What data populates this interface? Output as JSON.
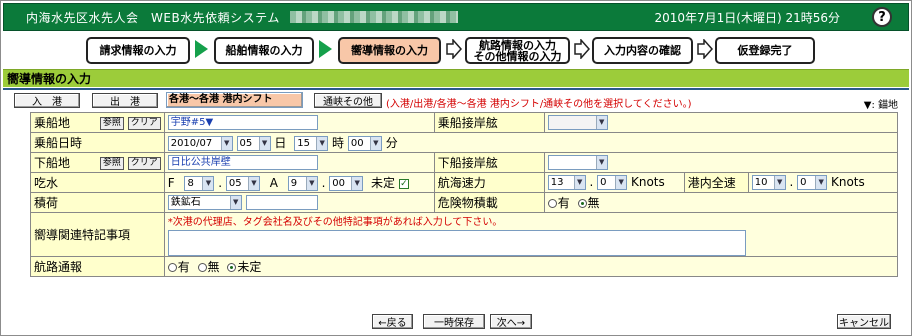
{
  "header": {
    "title": "内海水先区水先人会　WEB水先依頼システム",
    "datetime": "2010年7月1日(木曜日) 21時56分",
    "help_label": "?"
  },
  "steps": [
    {
      "label": "請求情報の入力"
    },
    {
      "label": "船舶情報の入力"
    },
    {
      "label": "嚮導情報の入力"
    },
    {
      "label": "航路情報の入力\nその他情報の入力"
    },
    {
      "label": "入力内容の確認"
    },
    {
      "label": "仮登録完了"
    }
  ],
  "section_title": "嚮導情報の入力",
  "tabs": {
    "entry": "入　港",
    "exit": "出　港",
    "shift": "各港〜各港 港内シフト",
    "other": "通峡その他"
  },
  "tab_note": "(入港/出港/各港〜各港 港内シフト/通峡その他を選択してください。)",
  "legend": "▼: 錨地",
  "form": {
    "boarding_place_label": "乗船地",
    "ref_label": "参照",
    "clear_label": "クリア",
    "boarding_place_value": "宇野#5▼",
    "boarding_berth_label": "乗船接岸舷",
    "boarding_datetime_label": "乗船日時",
    "date_value": "2010/07",
    "day_value": "05",
    "day_unit": "日",
    "hour_value": "15",
    "hour_unit": "時",
    "minute_value": "00",
    "minute_unit": "分",
    "landing_place_label": "下船地",
    "landing_place_value": "日比公共岸壁",
    "landing_berth_label": "下船接岸舷",
    "draft_label": "吃水",
    "fore_label": "F",
    "fore_m": "8",
    "fore_cm": "05",
    "aft_label": "A",
    "aft_m": "9",
    "aft_cm": "00",
    "undecided_label": "未定",
    "nav_speed_label": "航海速力",
    "nav_speed_int": "13",
    "nav_speed_dec": "0",
    "knots_unit": "Knots",
    "harbor_speed_label": "港内全速",
    "harbor_speed_int": "10",
    "harbor_speed_dec": "0",
    "cargo_label": "積荷",
    "cargo_value": "鉄鉱石",
    "danger_label": "危険物積載",
    "yes_label": "有",
    "no_label": "無",
    "special_label": "嚮導関連特記事項",
    "special_note": "*次港の代理店、タグ会社名及びその他特記事項があれば入力して下さい。",
    "channel_label": "航路通報",
    "channel_yes": "有",
    "channel_no": "無",
    "channel_undecided": "未定"
  },
  "footer": {
    "back": "←戻る",
    "temp_save": "一時保存",
    "next": "次へ→",
    "cancel": "キャンセル"
  },
  "colors": {
    "header_bg": "#0b7a3a",
    "section_bg": "#9ccc3a",
    "current_step": "#f8c7a8",
    "form_bg": "#ffffdd",
    "note_red": "#d40000"
  }
}
